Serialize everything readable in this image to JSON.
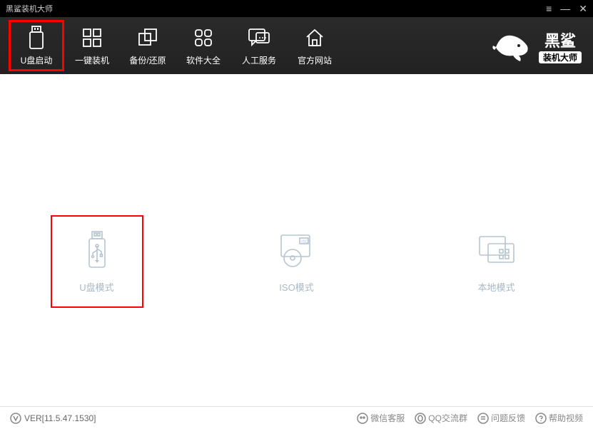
{
  "app": {
    "title": "黑鲨装机大师"
  },
  "nav": {
    "items": [
      {
        "label": "U盘启动"
      },
      {
        "label": "一键装机"
      },
      {
        "label": "备份/还原"
      },
      {
        "label": "软件大全"
      },
      {
        "label": "人工服务"
      },
      {
        "label": "官方网站"
      }
    ]
  },
  "brand": {
    "line1": "黑鲨",
    "line2": "装机大师"
  },
  "modes": {
    "usb": "U盘模式",
    "iso": "ISO模式",
    "local": "本地模式"
  },
  "footer": {
    "version": "VER[11.5.47.1530]",
    "links": [
      "微信客服",
      "QQ交流群",
      "问题反馈",
      "帮助视频"
    ]
  }
}
